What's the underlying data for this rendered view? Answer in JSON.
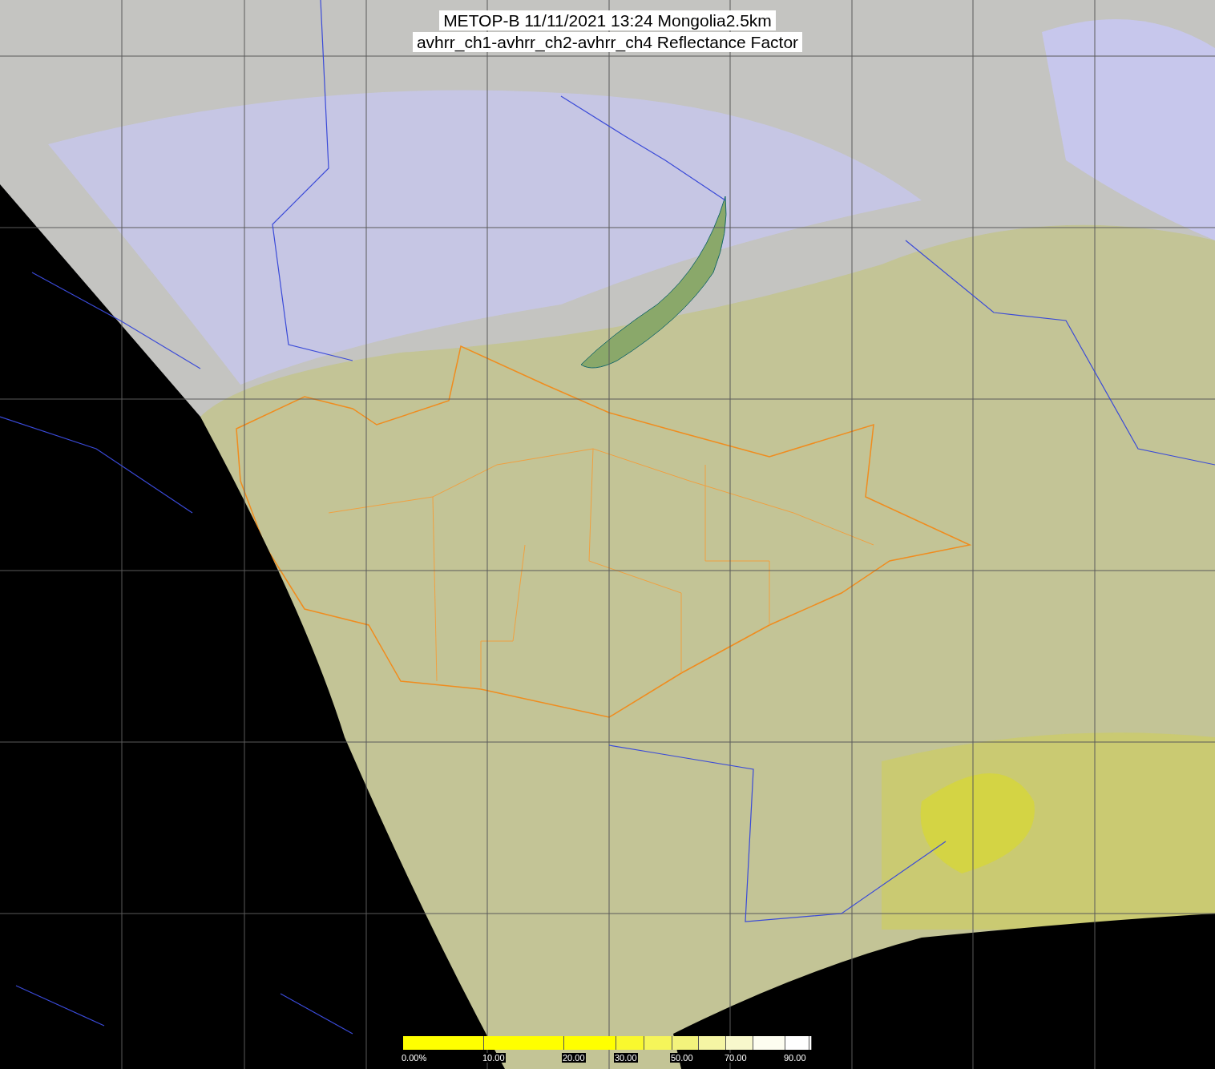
{
  "title": {
    "lines": [
      "METOP-B 11/11/2021 13:24 Mongolia2.5km",
      "avhrr_ch1-avhrr_ch2-avhrr_ch4 Reflectance Factor"
    ]
  },
  "colorbar": {
    "segments": [
      {
        "color": "#ffff00",
        "label": "0.00%"
      },
      {
        "color": "#ffff00",
        "label": "10.00"
      },
      {
        "color": "#ffff00",
        "label": "20.00"
      },
      {
        "color": "#f9f82e",
        "label": "30.00"
      },
      {
        "color": "#f5f55a"
      },
      {
        "color": "#f3f37c",
        "label": "50.00"
      },
      {
        "color": "#f5f5a4"
      },
      {
        "color": "#f8f8cc",
        "label": "70.00"
      },
      {
        "color": "#fdfdf0"
      },
      {
        "color": "#ffffff",
        "label": "90.00"
      },
      {
        "color": "#ffffff"
      }
    ]
  }
}
